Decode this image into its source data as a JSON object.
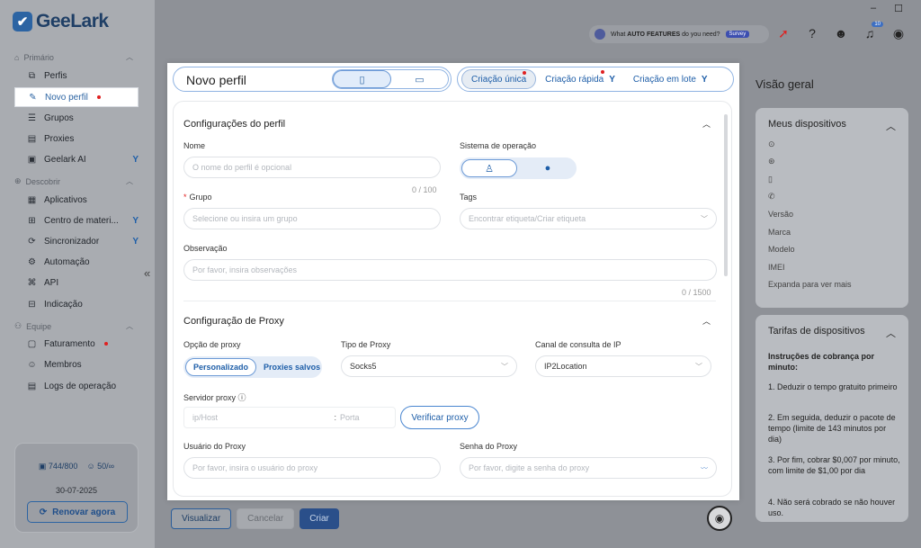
{
  "app": {
    "name": "GeeLark",
    "logo_icon": "geelark-logo"
  },
  "window": {
    "minimize": "–",
    "maximize": "☐"
  },
  "sidebar": {
    "sections": [
      {
        "label": "Primário",
        "items": [
          {
            "label": "Perfis",
            "icon": "profile-icon"
          },
          {
            "label": "Novo perfil",
            "icon": "edit-icon",
            "active": true,
            "dot": true
          },
          {
            "label": "Grupos",
            "icon": "list-icon"
          },
          {
            "label": "Proxies",
            "icon": "proxy-icon"
          },
          {
            "label": "Geelark AI",
            "icon": "ai-icon",
            "badge": true
          }
        ]
      },
      {
        "label": "Descobrir",
        "items": [
          {
            "label": "Aplicativos",
            "icon": "apps-icon"
          },
          {
            "label": "Centro de materi...",
            "icon": "materials-icon",
            "badge": true
          },
          {
            "label": "Sincronizador",
            "icon": "sync-icon",
            "badge": true
          },
          {
            "label": "Automação",
            "icon": "automation-icon"
          },
          {
            "label": "API",
            "icon": "api-icon"
          },
          {
            "label": "Indicação",
            "icon": "gift-icon"
          }
        ]
      },
      {
        "label": "Equipe",
        "items": [
          {
            "label": "Faturamento",
            "icon": "billing-icon",
            "dot": true
          },
          {
            "label": "Membros",
            "icon": "members-icon"
          },
          {
            "label": "Logs de operação",
            "icon": "logs-icon"
          }
        ]
      }
    ],
    "collapse": "«",
    "plan": {
      "devices": "744/800",
      "members": "50/∞",
      "date": "30-07-2025",
      "renew_label": "Renovar agora"
    }
  },
  "topbar": {
    "promo_prefix": "What",
    "promo_bold": "AUTO FEATURES",
    "promo_suffix": "do you need?",
    "survey": "Survey",
    "notification_count": "10",
    "icons": [
      "rocket-icon",
      "help-icon",
      "support-icon",
      "bell-icon",
      "user-icon"
    ]
  },
  "modal": {
    "title": "Novo perfil",
    "device_types": [
      {
        "name": "phone-icon",
        "selected": true
      },
      {
        "name": "laptop-icon",
        "selected": false
      }
    ],
    "tabs": [
      {
        "label": "Criação única",
        "selected": true,
        "dot": true
      },
      {
        "label": "Criação rápida",
        "dot": true
      },
      {
        "label": "Criação em lote"
      }
    ],
    "profile_config": {
      "title": "Configurações do perfil",
      "name_label": "Nome",
      "name_placeholder": "O nome do perfil é opcional",
      "name_count": "0 / 100",
      "os_label": "Sistema de operação",
      "os_options": [
        {
          "name": "android-icon",
          "selected": true
        },
        {
          "name": "apple-icon",
          "selected": false
        }
      ],
      "group_label": "Grupo",
      "group_placeholder": "Selecione ou insira um grupo",
      "tags_label": "Tags",
      "tags_placeholder": "Encontrar etiqueta/Criar etiqueta",
      "note_label": "Observação",
      "note_placeholder": "Por favor, insira observações",
      "note_count": "0 / 1500"
    },
    "proxy_config": {
      "title": "Configuração de Proxy",
      "option_label": "Opção de proxy",
      "options": [
        {
          "label": "Personalizado",
          "selected": true
        },
        {
          "label": "Proxies salvos"
        }
      ],
      "type_label": "Tipo de Proxy",
      "type_value": "Socks5",
      "channel_label": "Canal de consulta de IP",
      "channel_value": "IP2Location",
      "server_label": "Servidor proxy",
      "host_placeholder": "ip/Host",
      "port_placeholder": "Porta",
      "verify_label": "Verificar proxy",
      "user_label": "Usuário do Proxy",
      "user_placeholder": "Por favor, insira o usuário do proxy",
      "pass_label": "Senha do Proxy",
      "pass_placeholder": "Por favor, digite a senha do proxy"
    }
  },
  "footer": {
    "preview": "Visualizar",
    "cancel": "Cancelar",
    "create": "Criar"
  },
  "overview": {
    "title": "Visão geral",
    "devices_title": "Meus dispositivos",
    "device_fields": [
      "Versão",
      "Marca",
      "Modelo",
      "IMEI",
      "Expanda para ver mais"
    ],
    "device_icons": [
      "location-icon",
      "network-icon",
      "sim-icon",
      "phone-call-icon"
    ],
    "pricing_title": "Tarifas de dispositivos",
    "pricing_intro": "Instruções de cobrança por minuto:",
    "pricing_lines": [
      "1. Deduzir o tempo gratuito primeiro",
      "2. Em seguida, deduzir o pacote de tempo (limite de 143 minutos por dia)",
      "3. Por fim, cobrar $0,007 por minuto, com limite de $1,00 por dia",
      "4. Não será cobrado se não houver uso."
    ]
  }
}
